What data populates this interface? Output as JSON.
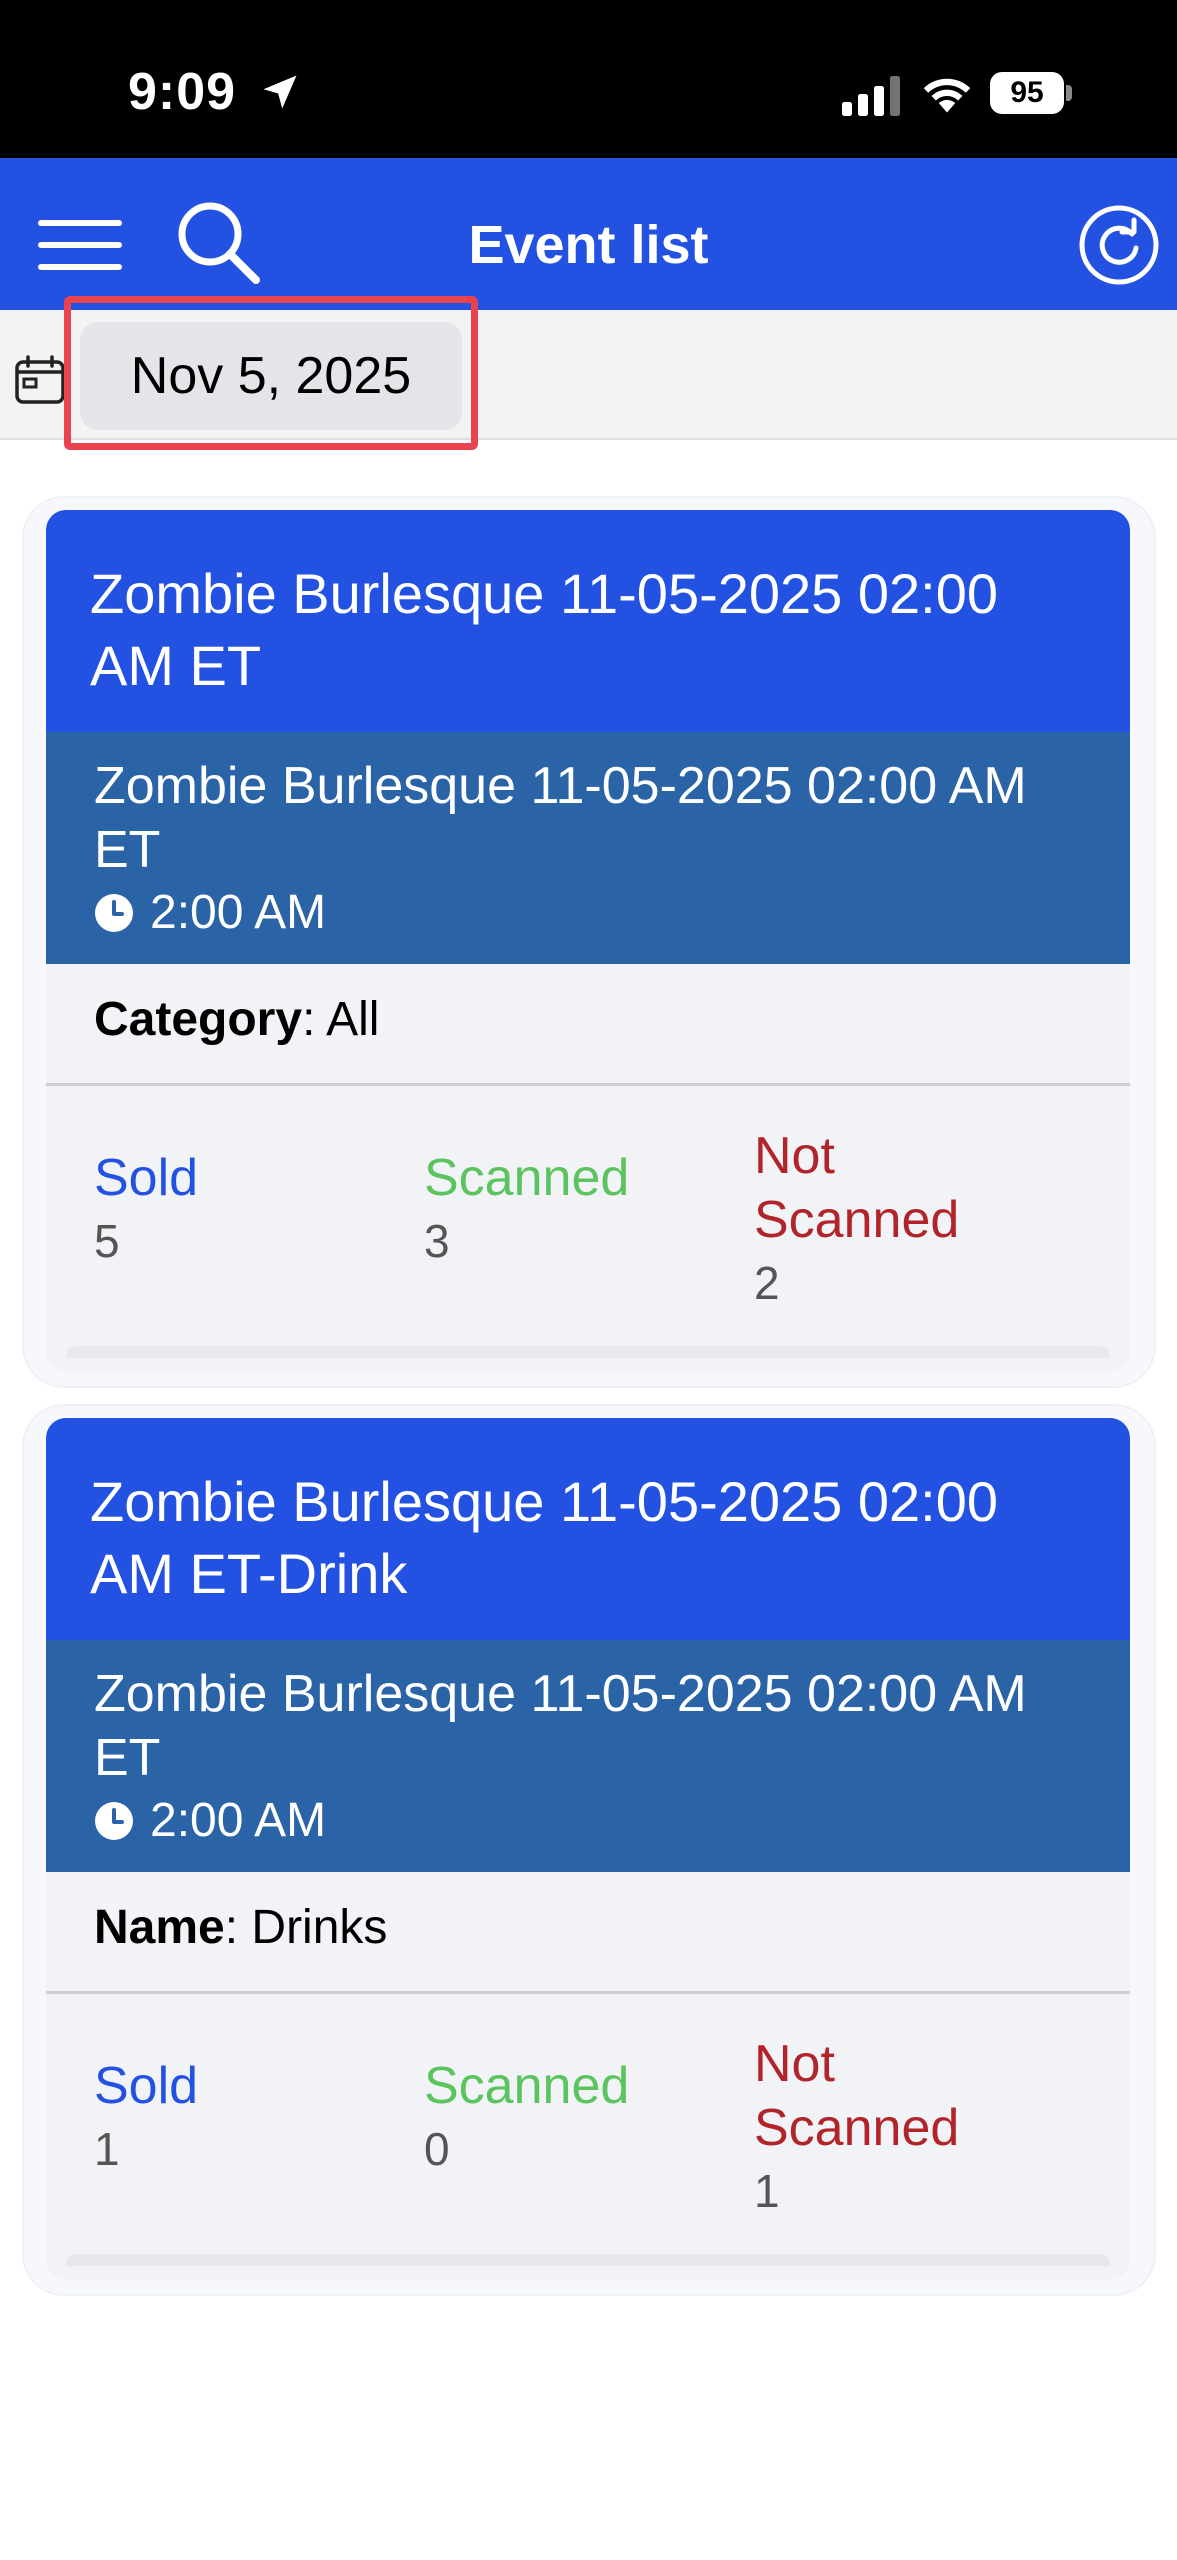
{
  "status_bar": {
    "time": "9:09",
    "battery": "95"
  },
  "header": {
    "title": "Event list"
  },
  "date_bar": {
    "selected_date": "Nov 5, 2025"
  },
  "events": [
    {
      "title": "Zombie Burlesque 11-05-2025 02:00 AM ET",
      "subtitle": "Zombie Burlesque 11-05-2025 02:00 AM ET",
      "time": "2:00 AM",
      "meta_key": "Category",
      "meta_value": "All",
      "sold_label": "Sold",
      "sold_value": "5",
      "scanned_label": "Scanned",
      "scanned_value": "3",
      "not_scanned_label": "Not Scanned",
      "not_scanned_value": "2"
    },
    {
      "title": "Zombie Burlesque 11-05-2025 02:00 AM ET-Drink",
      "subtitle": "Zombie Burlesque 11-05-2025 02:00 AM ET",
      "time": "2:00 AM",
      "meta_key": "Name",
      "meta_value": "Drinks",
      "sold_label": "Sold",
      "sold_value": "1",
      "scanned_label": "Scanned",
      "scanned_value": "0",
      "not_scanned_label": "Not Scanned",
      "not_scanned_value": "1"
    }
  ],
  "colors": {
    "primary_blue": "#2352e2",
    "subheader_blue": "#2a63a6",
    "scanned_green": "#5bc45e",
    "not_scanned_red": "#b0242a",
    "highlight_red": "#e8434f"
  },
  "icons": {
    "status": [
      "location-arrow-icon",
      "cellular-signal-icon",
      "wifi-icon",
      "battery-icon"
    ],
    "header": [
      "menu-icon",
      "search-icon",
      "refresh-icon"
    ],
    "date_bar": [
      "calendar-icon"
    ],
    "card": [
      "clock-icon"
    ]
  }
}
